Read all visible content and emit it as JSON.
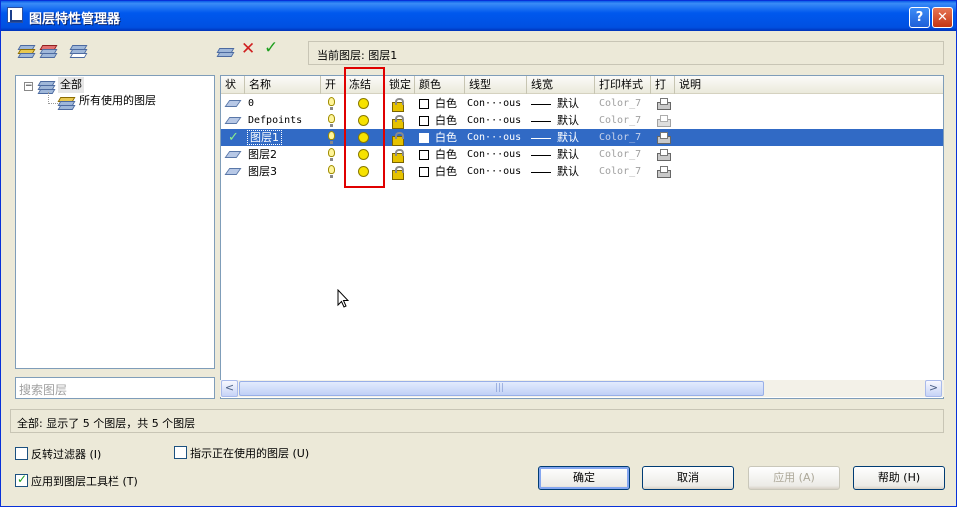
{
  "window": {
    "title": "图层特性管理器",
    "help_button": "?",
    "close_button": "✕"
  },
  "current_layer": {
    "label": "当前图层: 图层1"
  },
  "tree": {
    "root_label": "全部",
    "toggle": "−",
    "child_label": "所有使用的图层"
  },
  "search": {
    "placeholder": "搜索图层"
  },
  "columns": [
    "状",
    "名称",
    "开",
    "冻结",
    "锁定",
    "颜色",
    "线型",
    "线宽",
    "打印样式",
    "打",
    "说明"
  ],
  "layers": [
    {
      "name": "0",
      "color": "白色",
      "linetype": "Con···ous",
      "lineweight": "默认",
      "plot_style": "Color_7",
      "current": false,
      "selected": false
    },
    {
      "name": "Defpoints",
      "color": "白色",
      "linetype": "Con···ous",
      "lineweight": "默认",
      "plot_style": "Color_7",
      "current": false,
      "selected": false
    },
    {
      "name": "图层1",
      "color": "白色",
      "linetype": "Con···ous",
      "lineweight": "默认",
      "plot_style": "Color_7",
      "current": true,
      "selected": true
    },
    {
      "name": "图层2",
      "color": "白色",
      "linetype": "Con···ous",
      "lineweight": "默认",
      "plot_style": "Color_7",
      "current": false,
      "selected": false
    },
    {
      "name": "图层3",
      "color": "白色",
      "linetype": "Con···ous",
      "lineweight": "默认",
      "plot_style": "Color_7",
      "current": false,
      "selected": false
    }
  ],
  "scrollbar": {
    "left_arrow": "<",
    "right_arrow": ">",
    "grip": "|||"
  },
  "status": {
    "text": "全部: 显示了 5 个图层，共 5 个图层"
  },
  "options": {
    "invert_filter": "反转过滤器 (I)",
    "indicate_used": "指示正在使用的图层 (U)",
    "apply_to_toolbar": "应用到图层工具栏 (T)",
    "invert_filter_checked": false,
    "indicate_used_checked": false,
    "apply_to_toolbar_checked": true
  },
  "buttons": {
    "ok": "确定",
    "cancel": "取消",
    "apply": "应用 (A)",
    "help": "帮助 (H)"
  },
  "toolbar_icons": [
    "new-property-filter-icon",
    "new-group-filter-icon",
    "layer-states-manager-icon",
    "new-layer-icon",
    "delete-layer-icon",
    "set-current-icon"
  ],
  "colors": {
    "titlebar": "#0058ee",
    "selection": "#316ac5",
    "highlight_box": "#e00000"
  }
}
